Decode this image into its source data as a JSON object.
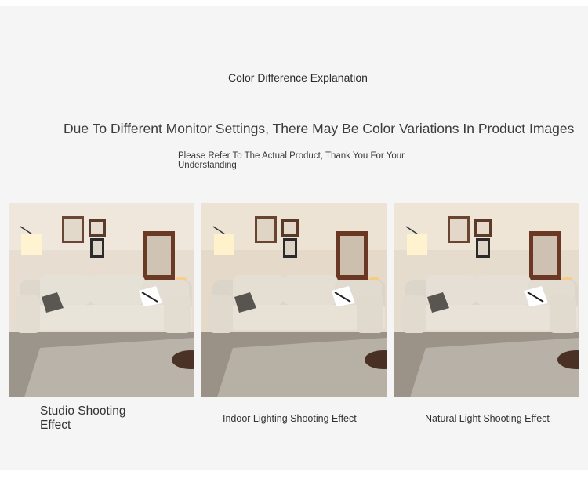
{
  "header": {
    "title": "Color Difference Explanation",
    "subtitle": "Due To Different Monitor Settings, There May Be Color Variations In Product Images",
    "note": "Please Refer To The Actual Product, Thank You For Your Understanding"
  },
  "photos": [
    {
      "caption": "Studio Shooting Effect"
    },
    {
      "caption": "Indoor Lighting Shooting Effect"
    },
    {
      "caption": "Natural Light Shooting Effect"
    }
  ]
}
